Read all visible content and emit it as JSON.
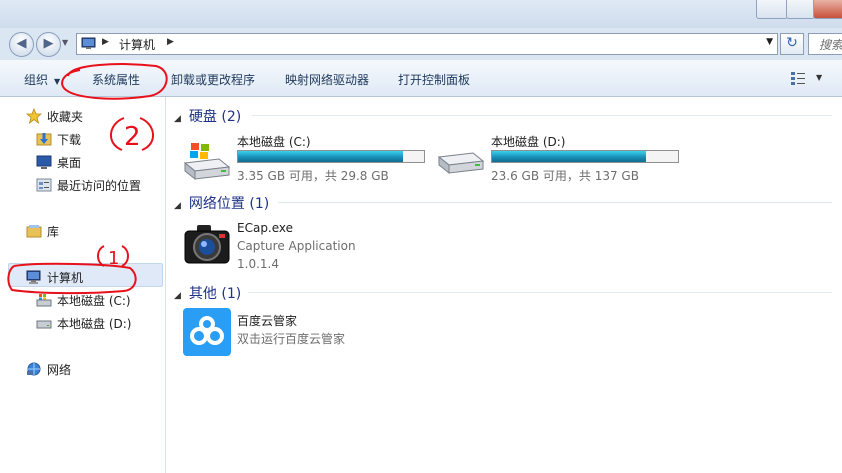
{
  "address": {
    "location": "计算机",
    "search_placeholder": "搜索"
  },
  "toolbar": {
    "organize": "组织",
    "system_properties": "系统属性",
    "uninstall": "卸载或更改程序",
    "map_drive": "映射网络驱动器",
    "control_panel": "打开控制面板"
  },
  "nav": {
    "favorites": "收藏夹",
    "downloads": "下载",
    "desktop": "桌面",
    "recent": "最近访问的位置",
    "libraries": "库",
    "computer": "计算机",
    "drive_c": "本地磁盘 (C:)",
    "drive_d": "本地磁盘 (D:)",
    "network": "网络"
  },
  "groups": {
    "hard_disks": "硬盘 (2)",
    "network_locations": "网络位置 (1)",
    "other": "其他 (1)"
  },
  "drives": [
    {
      "name": "本地磁盘 (C:)",
      "free_text": "3.35 GB 可用，共 29.8 GB",
      "used_fraction": 0.888
    },
    {
      "name": "本地磁盘 (D:)",
      "free_text": "23.6 GB 可用，共 137 GB",
      "used_fraction": 0.828
    }
  ],
  "network_item": {
    "name": "ECap.exe",
    "description": "Capture Application",
    "version": "1.0.1.4"
  },
  "other_item": {
    "name": "百度云管家",
    "description": "双击运行百度云管家"
  },
  "annotations": {
    "mark_1": "1",
    "mark_2": "2"
  },
  "colors": {
    "annotation": "#e8101a",
    "group_header": "#1e3287",
    "drive_bar": "#26a0da"
  }
}
